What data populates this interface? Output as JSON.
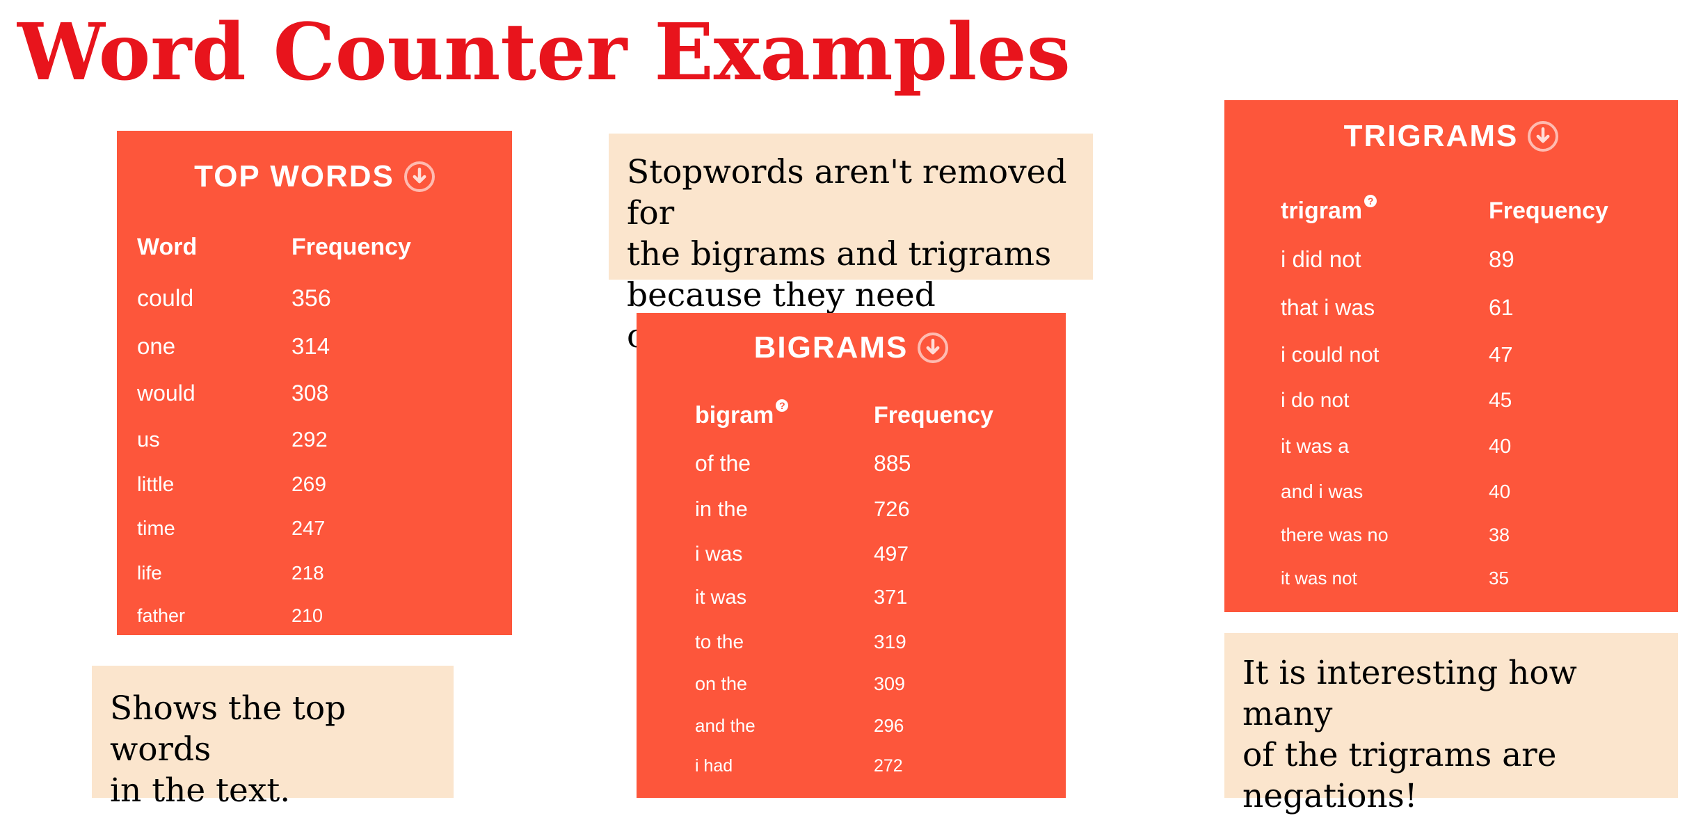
{
  "title": "Word Counter Examples",
  "colors": {
    "title": "#e8141c",
    "panel": "#fd563b",
    "note": "#fbe5cd"
  },
  "top_words": {
    "heading": "TOP WORDS",
    "icon": "download-circle-icon",
    "col_word": "Word",
    "col_freq": "Frequency",
    "rows": [
      {
        "term": "could",
        "freq": "356"
      },
      {
        "term": "one",
        "freq": "314"
      },
      {
        "term": "would",
        "freq": "308"
      },
      {
        "term": "us",
        "freq": "292"
      },
      {
        "term": "little",
        "freq": "269"
      },
      {
        "term": "time",
        "freq": "247"
      },
      {
        "term": "life",
        "freq": "218"
      },
      {
        "term": "father",
        "freq": "210"
      }
    ]
  },
  "bigrams": {
    "heading": "BIGRAMS",
    "icon": "download-circle-icon",
    "col_word": "bigram",
    "help": "?",
    "col_freq": "Frequency",
    "rows": [
      {
        "term": "of the",
        "freq": "885"
      },
      {
        "term": "in the",
        "freq": "726"
      },
      {
        "term": "i was",
        "freq": "497"
      },
      {
        "term": "it was",
        "freq": "371"
      },
      {
        "term": "to the",
        "freq": "319"
      },
      {
        "term": "on the",
        "freq": "309"
      },
      {
        "term": "and the",
        "freq": "296"
      },
      {
        "term": "i had",
        "freq": "272"
      }
    ]
  },
  "trigrams": {
    "heading": "TRIGRAMS",
    "icon": "download-circle-icon",
    "col_word": "trigram",
    "help": "?",
    "col_freq": "Frequency",
    "rows": [
      {
        "term": "i did not",
        "freq": "89"
      },
      {
        "term": "that i was",
        "freq": "61"
      },
      {
        "term": "i could not",
        "freq": "47"
      },
      {
        "term": "i do not",
        "freq": "45"
      },
      {
        "term": "it was a",
        "freq": "40"
      },
      {
        "term": "and i was",
        "freq": "40"
      },
      {
        "term": "there was no",
        "freq": "38"
      },
      {
        "term": "it was not",
        "freq": "35"
      }
    ]
  },
  "notes": {
    "top_words": [
      "Shows the top words",
      "in the text."
    ],
    "stopwords": [
      "Stopwords aren't removed for",
      "the bigrams and trigrams",
      "because they need context."
    ],
    "trigrams": [
      "It is interesting how many",
      "of the trigrams are",
      "negations!"
    ]
  }
}
